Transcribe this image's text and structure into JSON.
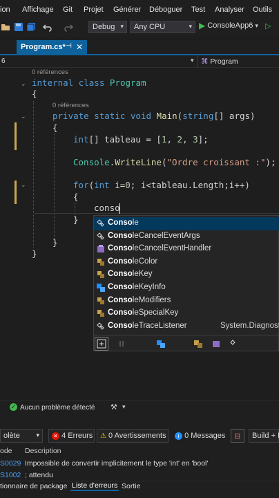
{
  "menu": [
    "ion",
    "Affichage",
    "Git",
    "Projet",
    "Générer",
    "Déboguer",
    "Test",
    "Analyser",
    "Outils"
  ],
  "toolbar": {
    "config": "Debug",
    "platform": "Any CPU",
    "run_label": "ConsoleApp6"
  },
  "tab": {
    "label": "Program.cs*",
    "pin": "⊣",
    "close": "✕"
  },
  "navbar": {
    "left": "6",
    "member": "Program"
  },
  "code": {
    "ref1": "0 références",
    "line1": "internal class Program",
    "brace_open1": "{",
    "ref2": "0 références",
    "line_main": "private static void Main(string[] args)",
    "brace_open2": "{",
    "line_array": "int[] tableau = [1, 2, 3];",
    "line_write": "Console.WriteLine(\"Ordre croissant :\");",
    "line_for": "for(int i=0; i<tableau.Length;i++)",
    "brace_open3": "{",
    "line_typed": "conso",
    "brace_close3": "}",
    "brace_close2": "}",
    "brace_close1": "}"
  },
  "autocomplete": {
    "items": [
      {
        "match": "Conso",
        "rest": "le",
        "kind": "class"
      },
      {
        "match": "Conso",
        "rest": "leCancelEventArgs",
        "kind": "class"
      },
      {
        "match": "Conso",
        "rest": "leCancelEventHandler",
        "kind": "delegate"
      },
      {
        "match": "Conso",
        "rest": "leColor",
        "kind": "enum"
      },
      {
        "match": "Conso",
        "rest": "leKey",
        "kind": "enum"
      },
      {
        "match": "Conso",
        "rest": "leKeyInfo",
        "kind": "struct"
      },
      {
        "match": "Conso",
        "rest": "leModifiers",
        "kind": "enum"
      },
      {
        "match": "Conso",
        "rest": "leSpecialKey",
        "kind": "enum"
      },
      {
        "match": "Conso",
        "rest": "leTraceListener",
        "kind": "class"
      }
    ],
    "namespace_hint": "System.Diagnost"
  },
  "status": {
    "no_issues": "Aucun problème détecté"
  },
  "errorlist": {
    "scope": "olète",
    "errors": "4 Erreurs",
    "warnings": "0 Avertissements",
    "messages": "0 Messages",
    "build": "Build + I",
    "col_code": "ode",
    "col_desc": "Description",
    "rows": [
      {
        "code": "S0029",
        "desc": "Impossible de convertir implicitement le type 'int' en 'bool'"
      },
      {
        "code": "S1002",
        "desc": "; attendu"
      }
    ],
    "tabs": [
      "tionnaire de package",
      "Liste d'erreurs",
      "Sortie"
    ]
  },
  "colors": {
    "accent": "#0e639c",
    "keyword": "#569cd6",
    "type": "#4ec9b0",
    "method": "#dcdcaa",
    "string": "#d69d85"
  }
}
